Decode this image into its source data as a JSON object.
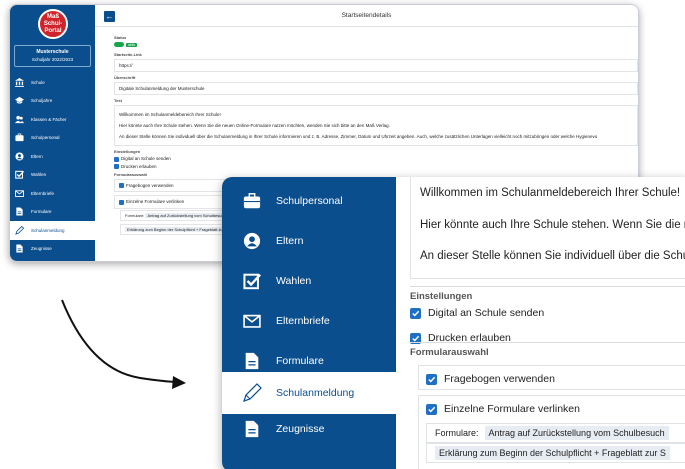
{
  "small_screenshot": {
    "logo_top": "Maß",
    "logo_bottom": "Schul-Portal",
    "school_name": "Musterschule",
    "school_year": "Schuljahr 2022/2023",
    "nav": [
      {
        "label": "Schule",
        "icon": "school-icon"
      },
      {
        "label": "Schuljahre",
        "icon": "graduation-cap-icon"
      },
      {
        "label": "Klassen & Fächer",
        "icon": "users-icon"
      },
      {
        "label": "Schulpersonal",
        "icon": "briefcase-icon"
      },
      {
        "label": "Eltern",
        "icon": "user-circle-icon"
      },
      {
        "label": "Wahlen",
        "icon": "check-square-icon"
      },
      {
        "label": "Elternbriefe",
        "icon": "envelope-icon"
      },
      {
        "label": "Formulare",
        "icon": "document-icon"
      },
      {
        "label": "Schulanmeldung",
        "icon": "pen-icon"
      },
      {
        "label": "Zeugnisse",
        "icon": "document-icon"
      }
    ],
    "active_nav": "Schulanmeldung",
    "page_title": "Startseitendetails",
    "status_label": "Status",
    "status_badge": "aktiv",
    "link_label": "Startseite-Link",
    "link_value": "https://",
    "heading_label": "Überschrift",
    "heading_value": "Digitale Schulanmeldung der Musterschule",
    "text_label": "Text",
    "text_lines": [
      "Willkommen im Schulanmeldebereich Ihrer Schule!",
      "Hier könnte auch Ihre Schule stehen. Wenn Sie die neuen Online-Formulare nutzen möchten, wenden Sie sich bitte an den Maß Verlag.",
      "An dieser Stelle können Sie individuell über die Schulanmeldung in Ihrer Schule informieren und z. B. Adresse, Zimmer, Datum und Uhrzeit angeben. Auch, welche zusätzlichen Unterlagen vielleicht noch mitzubringen oder welche Hygienevo"
    ],
    "settings_label": "Einstellungen",
    "settings": [
      "Digital an Schule senden",
      "Drucken erlauben"
    ],
    "form_label": "Formularauswahl",
    "form_options": [
      "Fragebogen verwenden",
      "Einzelne Formulare verlinken"
    ],
    "forms_prefix": "Formulare:",
    "forms": [
      "Antrag auf Zurückstellung vom Schulbesuch",
      "Erklärung zum Beginn der Schulpflicht + Frageblatt zur Sc"
    ]
  },
  "zoomed_screenshot": {
    "nav": [
      {
        "label": "Schulpersonal",
        "icon": "briefcase-icon"
      },
      {
        "label": "Eltern",
        "icon": "user-circle-icon"
      },
      {
        "label": "Wahlen",
        "icon": "check-square-icon"
      },
      {
        "label": "Elternbriefe",
        "icon": "envelope-icon"
      },
      {
        "label": "Formulare",
        "icon": "document-icon"
      },
      {
        "label": "Schulanmeldung",
        "icon": "pen-icon"
      },
      {
        "label": "Zeugnisse",
        "icon": "document-icon"
      }
    ],
    "active_nav": "Schulanmeldung",
    "text_lines": [
      "Willkommen im Schulanmeldebereich Ihrer Schule!",
      "Hier könnte auch Ihre Schule stehen. Wenn Sie die n",
      "An dieser Stelle können Sie individuell über die Schu"
    ],
    "settings_label": "Einstellungen",
    "settings": [
      "Digital an Schule senden",
      "Drucken erlauben"
    ],
    "form_label": "Formularauswahl",
    "form_options": [
      "Fragebogen verwenden",
      "Einzelne Formulare verlinken"
    ],
    "forms_prefix": "Formulare:",
    "forms": [
      "Antrag auf Zurückstellung vom Schulbesuch",
      "Erklärung zum Beginn der Schulpflicht + Frageblatt zur S"
    ]
  },
  "colors": {
    "sidebar": "#0b4e8e",
    "active_text": "#0b4e8e",
    "toggle_green": "#18a54a",
    "checkbox_blue": "#1f6fc5"
  }
}
